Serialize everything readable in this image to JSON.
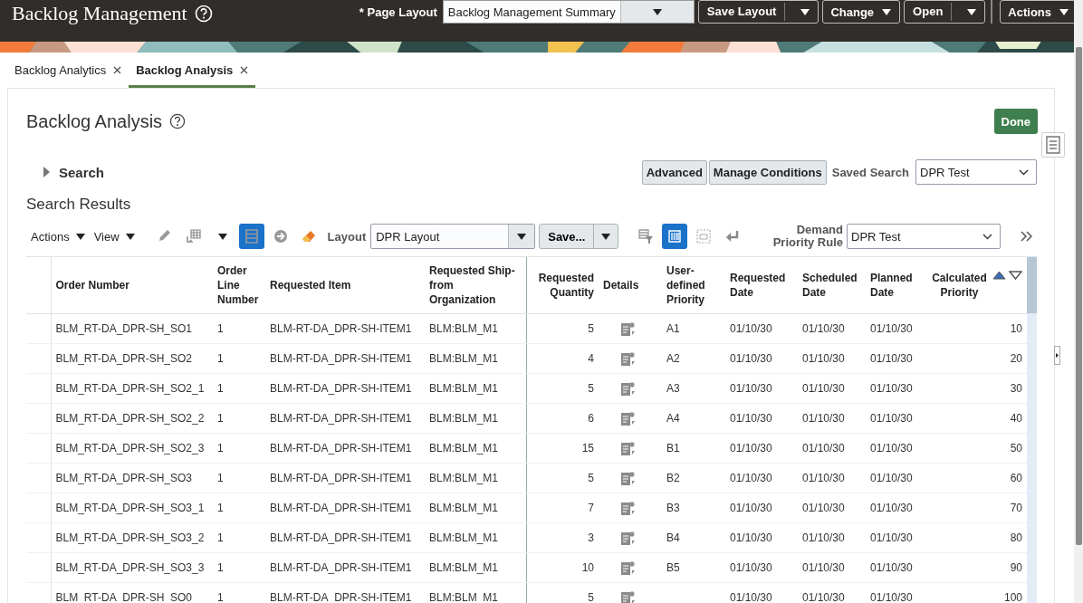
{
  "header": {
    "title": "Backlog Management",
    "page_layout_label": "* Page Layout",
    "page_layout_value": "Backlog Management Summary",
    "buttons": [
      {
        "label": "Save Layout",
        "kind": "split"
      },
      {
        "label": "Change",
        "kind": "menu"
      },
      {
        "label": "Open",
        "kind": "split"
      },
      {
        "label": "Actions",
        "kind": "menu"
      }
    ]
  },
  "tabs": [
    {
      "label": "Backlog Analytics",
      "selected": false
    },
    {
      "label": "Backlog Analysis",
      "selected": true
    }
  ],
  "page": {
    "title": "Backlog Analysis",
    "done": "Done",
    "search": {
      "label": "Search",
      "expanded": false
    },
    "buttons": [
      "Advanced",
      "Manage Conditions"
    ],
    "saved_search": {
      "label": "Saved Search",
      "value": "DPR Test"
    }
  },
  "results": {
    "title": "Search Results",
    "menus": [
      "Actions",
      "View"
    ],
    "layout_label": "Layout",
    "layout_value": "DPR Layout",
    "save": "Save...",
    "priority_rule_label": "Demand Priority Rule",
    "priority_rule_value": "DPR Test",
    "tools_left": [
      {
        "kind": "pencil",
        "on": false
      },
      {
        "kind": "grid",
        "on": false
      },
      {
        "kind": "caret",
        "on": false
      },
      {
        "kind": "rows",
        "on": true
      },
      {
        "kind": "arrow",
        "on": false
      },
      {
        "kind": "eraser",
        "on": false
      }
    ],
    "tools_right": [
      {
        "kind": "filter",
        "on": false
      },
      {
        "kind": "columns",
        "on": true
      },
      {
        "kind": "detach",
        "on": false
      },
      {
        "kind": "wrap",
        "on": false
      }
    ]
  },
  "table": {
    "columns": [
      {
        "label": "Order Number",
        "kind": "text"
      },
      {
        "label": "Order Line Number",
        "kind": "text"
      },
      {
        "label": "Requested Item",
        "kind": "text"
      },
      {
        "label": "Requested Ship-from Organization",
        "kind": "text"
      },
      {
        "label": "Requested Quantity",
        "kind": "number"
      },
      {
        "label": "Details",
        "kind": "icon"
      },
      {
        "label": "User-defined Priority",
        "kind": "text"
      },
      {
        "label": "Requested Date",
        "kind": "text"
      },
      {
        "label": "Scheduled Date",
        "kind": "text"
      },
      {
        "label": "Planned Date",
        "kind": "text"
      },
      {
        "label": "Calculated Priority",
        "kind": "number",
        "sort_ascending": true
      }
    ],
    "rows": [
      {
        "cells": [
          "BLM_RT-DA_DPR-SH_SO1",
          "1",
          "BLM-RT-DA_DPR-SH-ITEM1",
          "BLM:BLM_M1",
          "5",
          null,
          "A1",
          "01/10/30",
          "01/10/30",
          "01/10/30",
          "10"
        ]
      },
      {
        "cells": [
          "BLM_RT-DA_DPR-SH_SO2",
          "1",
          "BLM-RT-DA_DPR-SH-ITEM1",
          "BLM:BLM_M1",
          "4",
          null,
          "A2",
          "01/10/30",
          "01/10/30",
          "01/10/30",
          "20"
        ]
      },
      {
        "cells": [
          "BLM_RT-DA_DPR-SH_SO2_1",
          "1",
          "BLM-RT-DA_DPR-SH-ITEM1",
          "BLM:BLM_M1",
          "5",
          null,
          "A3",
          "01/10/30",
          "01/10/30",
          "01/10/30",
          "30"
        ]
      },
      {
        "cells": [
          "BLM_RT-DA_DPR-SH_SO2_2",
          "1",
          "BLM-RT-DA_DPR-SH-ITEM1",
          "BLM:BLM_M1",
          "6",
          null,
          "A4",
          "01/10/30",
          "01/10/30",
          "01/10/30",
          "40"
        ]
      },
      {
        "cells": [
          "BLM_RT-DA_DPR-SH_SO2_3",
          "1",
          "BLM-RT-DA_DPR-SH-ITEM1",
          "BLM:BLM_M1",
          "15",
          null,
          "B1",
          "01/10/30",
          "01/10/30",
          "01/10/30",
          "50"
        ]
      },
      {
        "cells": [
          "BLM_RT-DA_DPR-SH_SO3",
          "1",
          "BLM-RT-DA_DPR-SH-ITEM1",
          "BLM:BLM_M1",
          "5",
          null,
          "B2",
          "01/10/30",
          "01/10/30",
          "01/10/30",
          "60"
        ]
      },
      {
        "cells": [
          "BLM_RT-DA_DPR-SH_SO3_1",
          "1",
          "BLM-RT-DA_DPR-SH-ITEM1",
          "BLM:BLM_M1",
          "7",
          null,
          "B3",
          "01/10/30",
          "01/10/30",
          "01/10/30",
          "70"
        ]
      },
      {
        "cells": [
          "BLM_RT-DA_DPR-SH_SO3_2",
          "1",
          "BLM-RT-DA_DPR-SH-ITEM1",
          "BLM:BLM_M1",
          "3",
          null,
          "B4",
          "01/10/30",
          "01/10/30",
          "01/10/30",
          "80"
        ]
      },
      {
        "cells": [
          "BLM_RT-DA_DPR-SH_SO3_3",
          "1",
          "BLM-RT-DA_DPR-SH-ITEM1",
          "BLM:BLM_M1",
          "10",
          null,
          "B5",
          "01/10/30",
          "01/10/30",
          "01/10/30",
          "90"
        ]
      },
      {
        "cells": [
          "BLM_RT-DA_DPR-SH_SO0",
          "1",
          "BLM-RT-DA_DPR-SH-ITEM1",
          "BLM:BLM_M1",
          "5",
          null,
          null,
          "01/10/30",
          "01/10/30",
          "01/10/30",
          "100"
        ]
      }
    ]
  }
}
